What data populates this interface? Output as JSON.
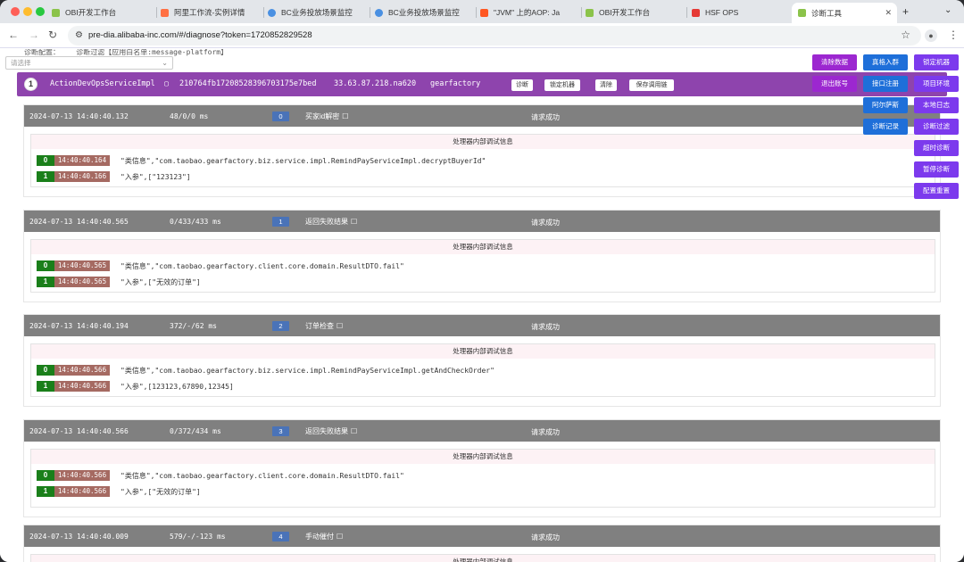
{
  "browser": {
    "tabs": [
      {
        "label": "OBI开发工作台",
        "icon_color": "#8bc34a"
      },
      {
        "label": "阿里工作流-实例详情",
        "icon_color": "#ff7043"
      },
      {
        "label": "BC业务投放场景监控",
        "icon_color": "#4a90e2"
      },
      {
        "label": "BC业务投放场景监控",
        "icon_color": "#4a90e2"
      },
      {
        "label": "\"JVM\" 上的AOP: Ja",
        "icon_color": "#ff5722"
      },
      {
        "label": "OBI开发工作台",
        "icon_color": "#8bc34a"
      },
      {
        "label": "HSF OPS",
        "icon_color": "#e53935"
      },
      {
        "label": "诊断工具",
        "icon_color": "#8bc34a"
      }
    ],
    "url": "pre-dia.alibaba-inc.com/#/diagnose?token=1720852829528"
  },
  "page": {
    "cut_label": "诊断配置：",
    "cut_filter": "诊断过滤【应用白名单:message-platform】",
    "select_placeholder": "请选择"
  },
  "trace": {
    "number": "1",
    "class_name": "ActionDevOpsServiceImpl",
    "trace_id": "210764fb17208528396703175e7bed",
    "ip": "33.63.87.218.na620",
    "app": "gearfactory",
    "buttons": [
      "诊断",
      "锁定机器",
      "清除",
      "保存调用链"
    ]
  },
  "side_buttons": [
    {
      "label": "清除数据",
      "color": "purple"
    },
    {
      "label": "真格入群",
      "color": "blue"
    },
    {
      "label": "锁定机器",
      "color": "violet"
    },
    {
      "label": "退出账号",
      "color": "purple"
    },
    {
      "label": "接口注册",
      "color": "blue"
    },
    {
      "label": "项目环境",
      "color": "violet"
    },
    {
      "label": "阿尔萨斯",
      "color": "blue"
    },
    {
      "label": "本地日志",
      "color": "violet"
    },
    {
      "label": "诊断记录",
      "color": "blue"
    },
    {
      "label": "诊断过滤",
      "color": "violet"
    },
    {
      "label": "超时诊断",
      "color": "violet"
    },
    {
      "label": "暂停诊断",
      "color": "violet"
    },
    {
      "label": "配置重置",
      "color": "violet"
    }
  ],
  "cards": [
    {
      "time": "2024-07-13 14:40:40.132",
      "ms": "48/0/0 ms",
      "index": "0",
      "name": "买家id解密",
      "status": "请求成功",
      "body_title": "处理器内部调试信息",
      "rows": [
        {
          "n": "0",
          "t": "14:40:40.164",
          "text": "\"类信息\",\"com.taobao.gearfactory.biz.service.impl.RemindPayServiceImpl.decryptBuyerId\""
        },
        {
          "n": "1",
          "t": "14:40:40.166",
          "text": "\"入参\",[\"123123\"]"
        }
      ]
    },
    {
      "time": "2024-07-13 14:40:40.565",
      "ms": "0/433/433 ms",
      "index": "1",
      "name": "返回失败结果",
      "status": "请求成功",
      "body_title": "处理器内部调试信息",
      "rows": [
        {
          "n": "0",
          "t": "14:40:40.565",
          "text": "\"类信息\",\"com.taobao.gearfactory.client.core.domain.ResultDTO.fail\""
        },
        {
          "n": "1",
          "t": "14:40:40.565",
          "text": "\"入参\",[\"无效的订单\"]"
        }
      ]
    },
    {
      "time": "2024-07-13 14:40:40.194",
      "ms": "372/-/62 ms",
      "index": "2",
      "name": "订单检查",
      "status": "请求成功",
      "body_title": "处理器内部调试信息",
      "rows": [
        {
          "n": "0",
          "t": "14:40:40.566",
          "text": "\"类信息\",\"com.taobao.gearfactory.biz.service.impl.RemindPayServiceImpl.getAndCheckOrder\""
        },
        {
          "n": "1",
          "t": "14:40:40.566",
          "text": "\"入参\",[123123,67890,12345]"
        }
      ]
    },
    {
      "time": "2024-07-13 14:40:40.566",
      "ms": "0/372/434 ms",
      "index": "3",
      "name": "返回失败结果",
      "status": "请求成功",
      "body_title": "处理器内部调试信息",
      "rows": [
        {
          "n": "0",
          "t": "14:40:40.566",
          "text": "\"类信息\",\"com.taobao.gearfactory.client.core.domain.ResultDTO.fail\""
        },
        {
          "n": "1",
          "t": "14:40:40.566",
          "text": "\"入参\",[\"无效的订单\"]"
        }
      ]
    },
    {
      "time": "2024-07-13 14:40:40.009",
      "ms": "579/-/-123 ms",
      "index": "4",
      "name": "手动催付",
      "status": "请求成功",
      "body_title": "处理器内部调试信息",
      "rows": []
    }
  ]
}
